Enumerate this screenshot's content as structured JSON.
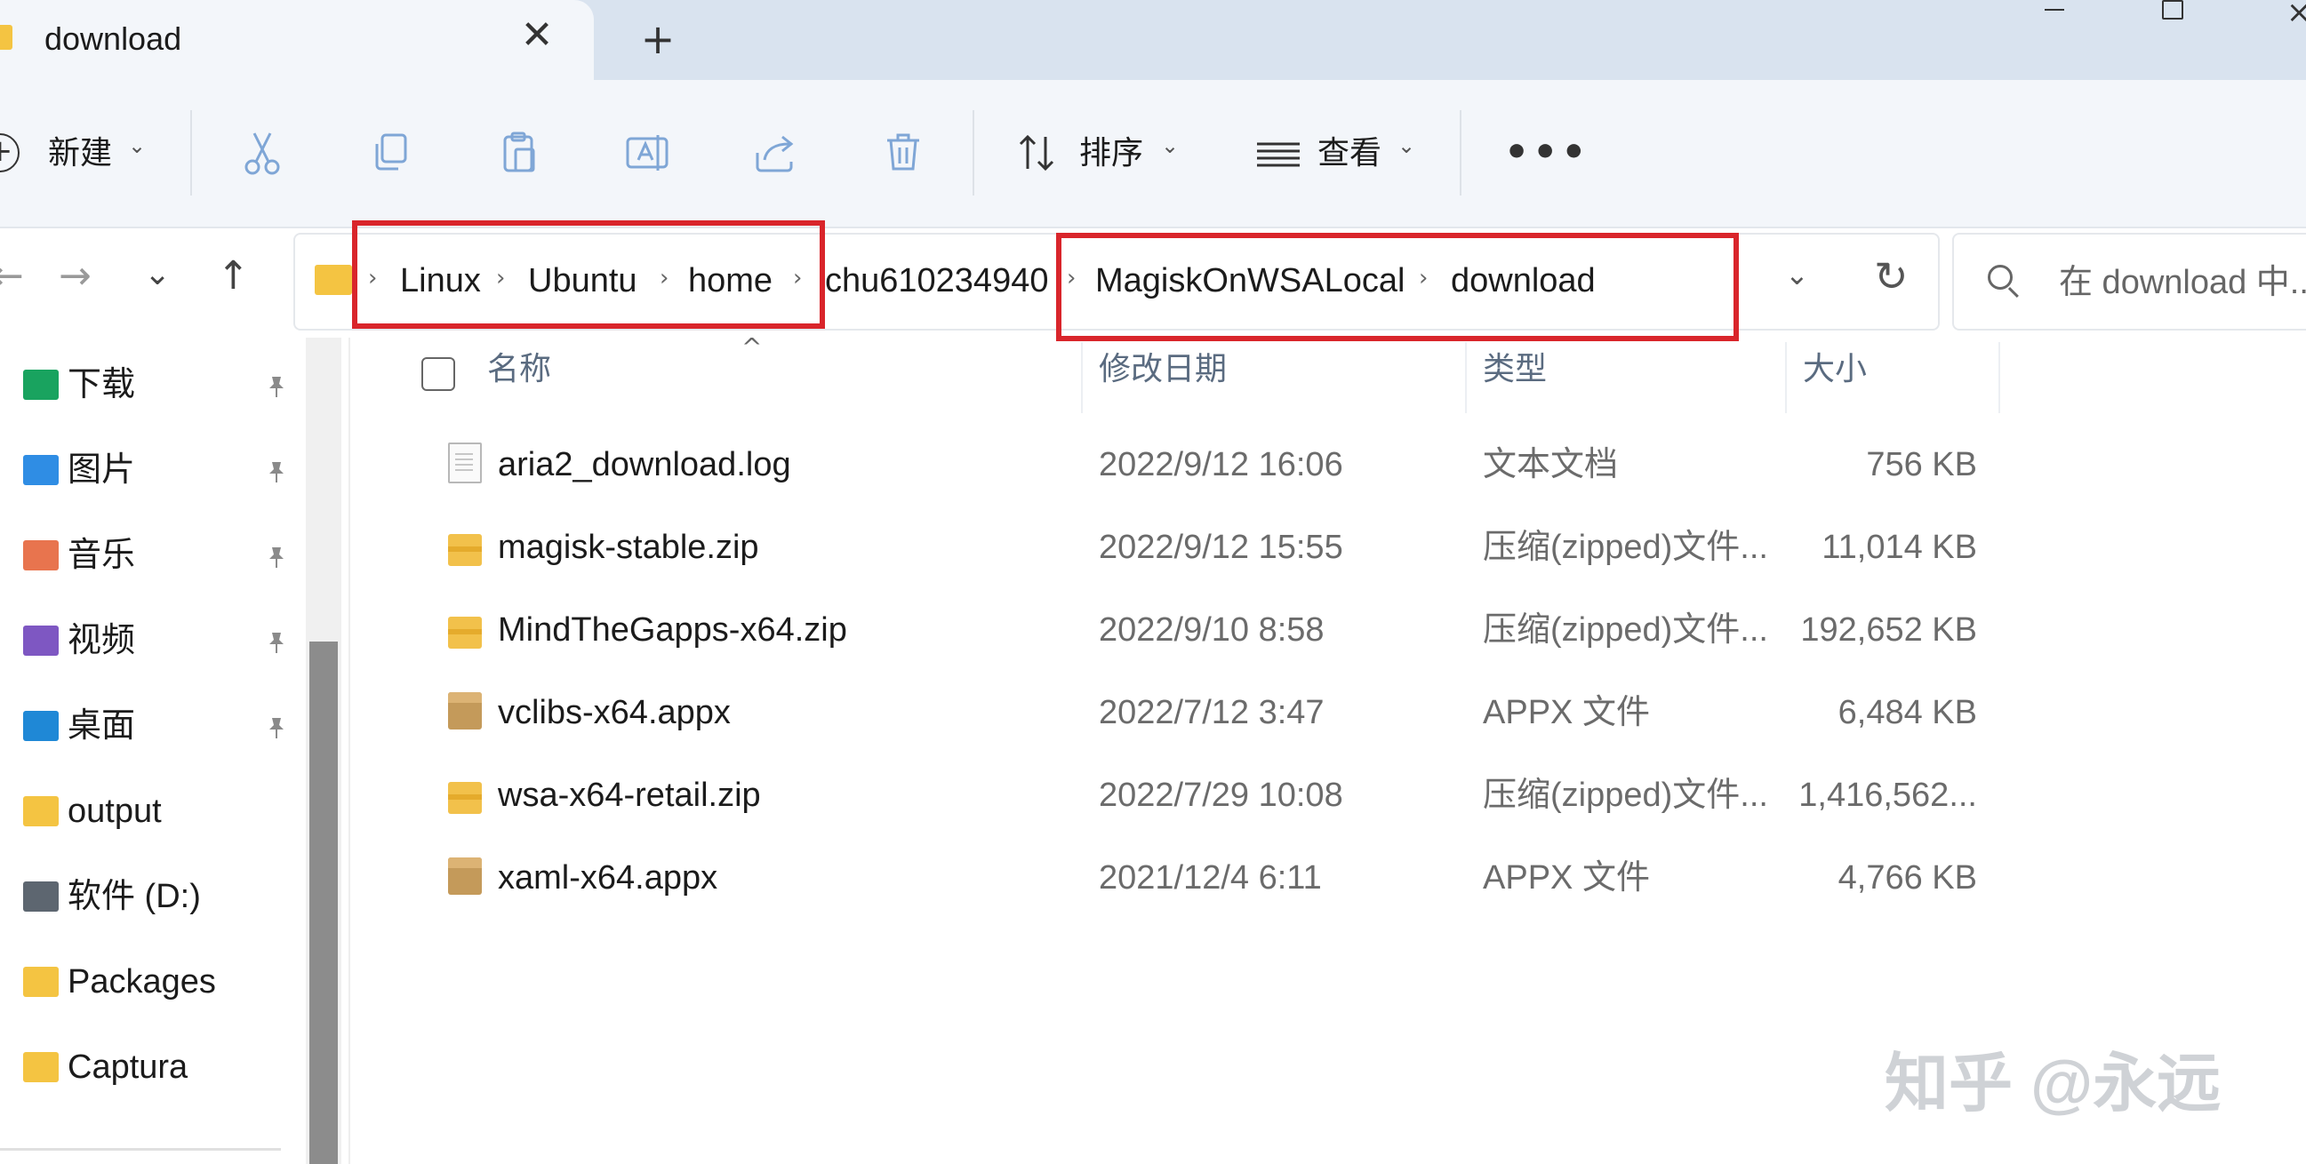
{
  "tab": {
    "title": "download",
    "close": "✕",
    "new": "+"
  },
  "window": {
    "close": "×"
  },
  "toolbar": {
    "new_label": "新建",
    "sort_label": "排序",
    "view_label": "查看",
    "more_label": "•••",
    "chevron": "⌄"
  },
  "nav": {
    "back": "←",
    "forward": "→",
    "recent": "⌄",
    "up": "↑"
  },
  "breadcrumb": {
    "items": [
      "Linux",
      "Ubuntu",
      "home",
      "chu610234940",
      "MagiskOnWSALocal",
      "download"
    ],
    "sep": "›"
  },
  "address": {
    "dropdown": "⌄",
    "refresh": "↻"
  },
  "search": {
    "placeholder": "在 download 中..."
  },
  "sidebar": {
    "items": [
      {
        "label": "下载",
        "icon": "download-folder-icon",
        "color": "#19a35f",
        "pinned": true
      },
      {
        "label": "图片",
        "icon": "pictures-folder-icon",
        "color": "#2f8de4",
        "pinned": true
      },
      {
        "label": "音乐",
        "icon": "music-folder-icon",
        "color": "#e8744e",
        "pinned": true
      },
      {
        "label": "视频",
        "icon": "videos-folder-icon",
        "color": "#7e57c2",
        "pinned": true
      },
      {
        "label": "桌面",
        "icon": "desktop-folder-icon",
        "color": "#1f88d6",
        "pinned": true
      },
      {
        "label": "output",
        "icon": "folder-icon",
        "color": "#f4c442",
        "pinned": false
      },
      {
        "label": "软件 (D:)",
        "icon": "drive-icon",
        "color": "#5d6670",
        "pinned": false
      },
      {
        "label": "Packages",
        "icon": "folder-icon",
        "color": "#f4c442",
        "pinned": false
      },
      {
        "label": "Captura",
        "icon": "folder-icon",
        "color": "#f4c442",
        "pinned": false
      }
    ],
    "pin_glyph": "📌"
  },
  "columns": {
    "name": "名称",
    "date": "修改日期",
    "type": "类型",
    "size": "大小",
    "sort_caret": "^"
  },
  "files": [
    {
      "name": "aria2_download.log",
      "date": "2022/9/12 16:06",
      "type": "文本文档",
      "size": "756 KB",
      "icon": "log"
    },
    {
      "name": "magisk-stable.zip",
      "date": "2022/9/12 15:55",
      "type": "压缩(zipped)文件...",
      "size": "11,014 KB",
      "icon": "zip"
    },
    {
      "name": "MindTheGapps-x64.zip",
      "date": "2022/9/10 8:58",
      "type": "压缩(zipped)文件...",
      "size": "192,652 KB",
      "icon": "zip"
    },
    {
      "name": "vclibs-x64.appx",
      "date": "2022/7/12 3:47",
      "type": "APPX 文件",
      "size": "6,484 KB",
      "icon": "appx"
    },
    {
      "name": "wsa-x64-retail.zip",
      "date": "2022/7/29 10:08",
      "type": "压缩(zipped)文件...",
      "size": "1,416,562...",
      "icon": "zip"
    },
    {
      "name": "xaml-x64.appx",
      "date": "2021/12/4 6:11",
      "type": "APPX 文件",
      "size": "4,766 KB",
      "icon": "appx"
    }
  ],
  "watermark": "知乎 @永远",
  "colors": {
    "highlight": "#d9252b",
    "tabbar": "#d9e3ef",
    "toolbar": "#f3f6fa"
  }
}
